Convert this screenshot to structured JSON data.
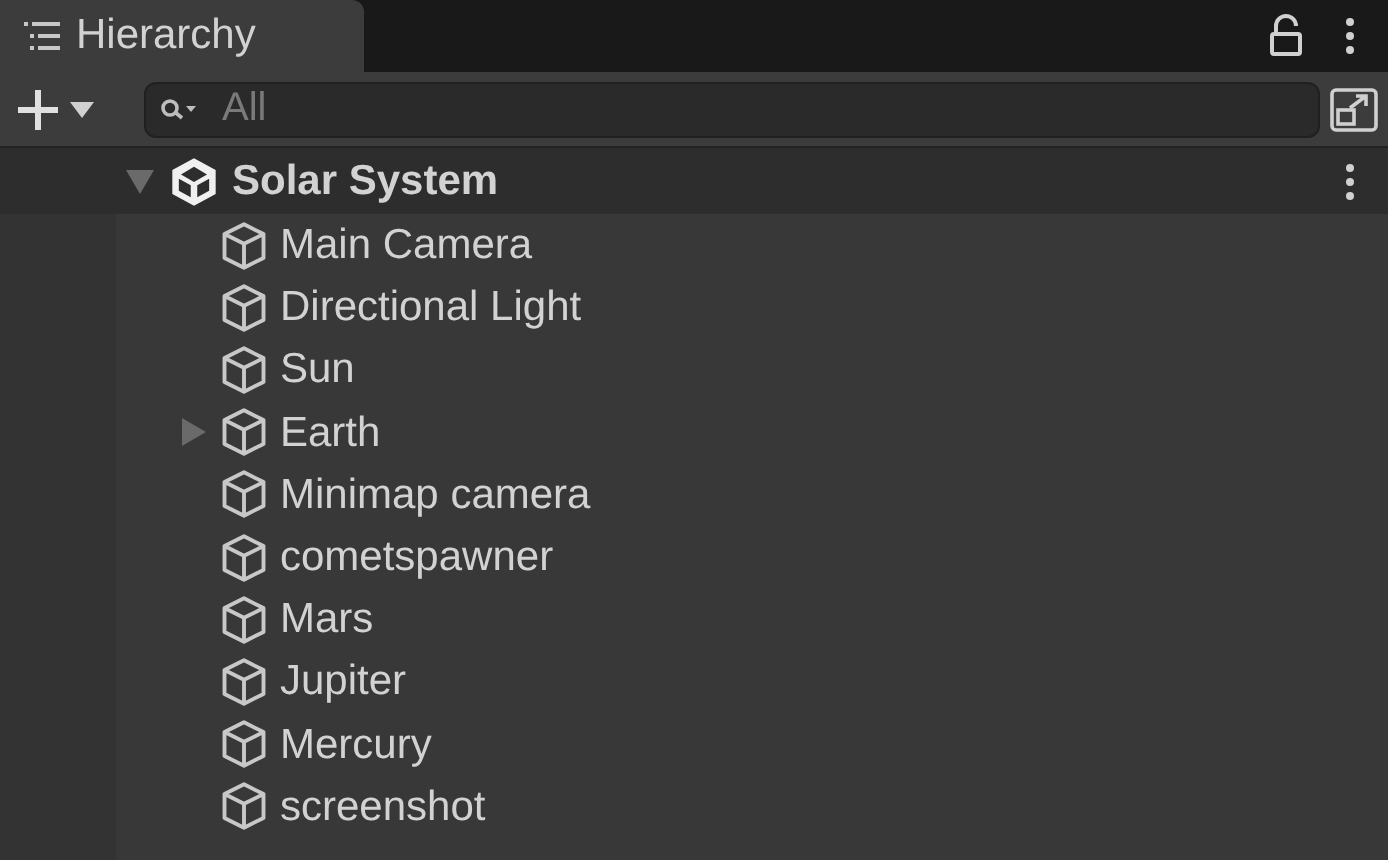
{
  "tab": {
    "title": "Hierarchy",
    "selected": true
  },
  "search": {
    "placeholder": "All"
  },
  "scene": {
    "name": "Solar System",
    "expanded": true,
    "children": [
      {
        "name": "Main Camera",
        "has_children": false
      },
      {
        "name": "Directional Light",
        "has_children": false
      },
      {
        "name": "Sun",
        "has_children": false
      },
      {
        "name": "Earth",
        "has_children": true
      },
      {
        "name": "Minimap camera",
        "has_children": false
      },
      {
        "name": "cometspawner",
        "has_children": false
      },
      {
        "name": "Mars",
        "has_children": false
      },
      {
        "name": "Jupiter",
        "has_children": false
      },
      {
        "name": "Mercury",
        "has_children": false
      },
      {
        "name": "screenshot",
        "has_children": false
      }
    ]
  }
}
